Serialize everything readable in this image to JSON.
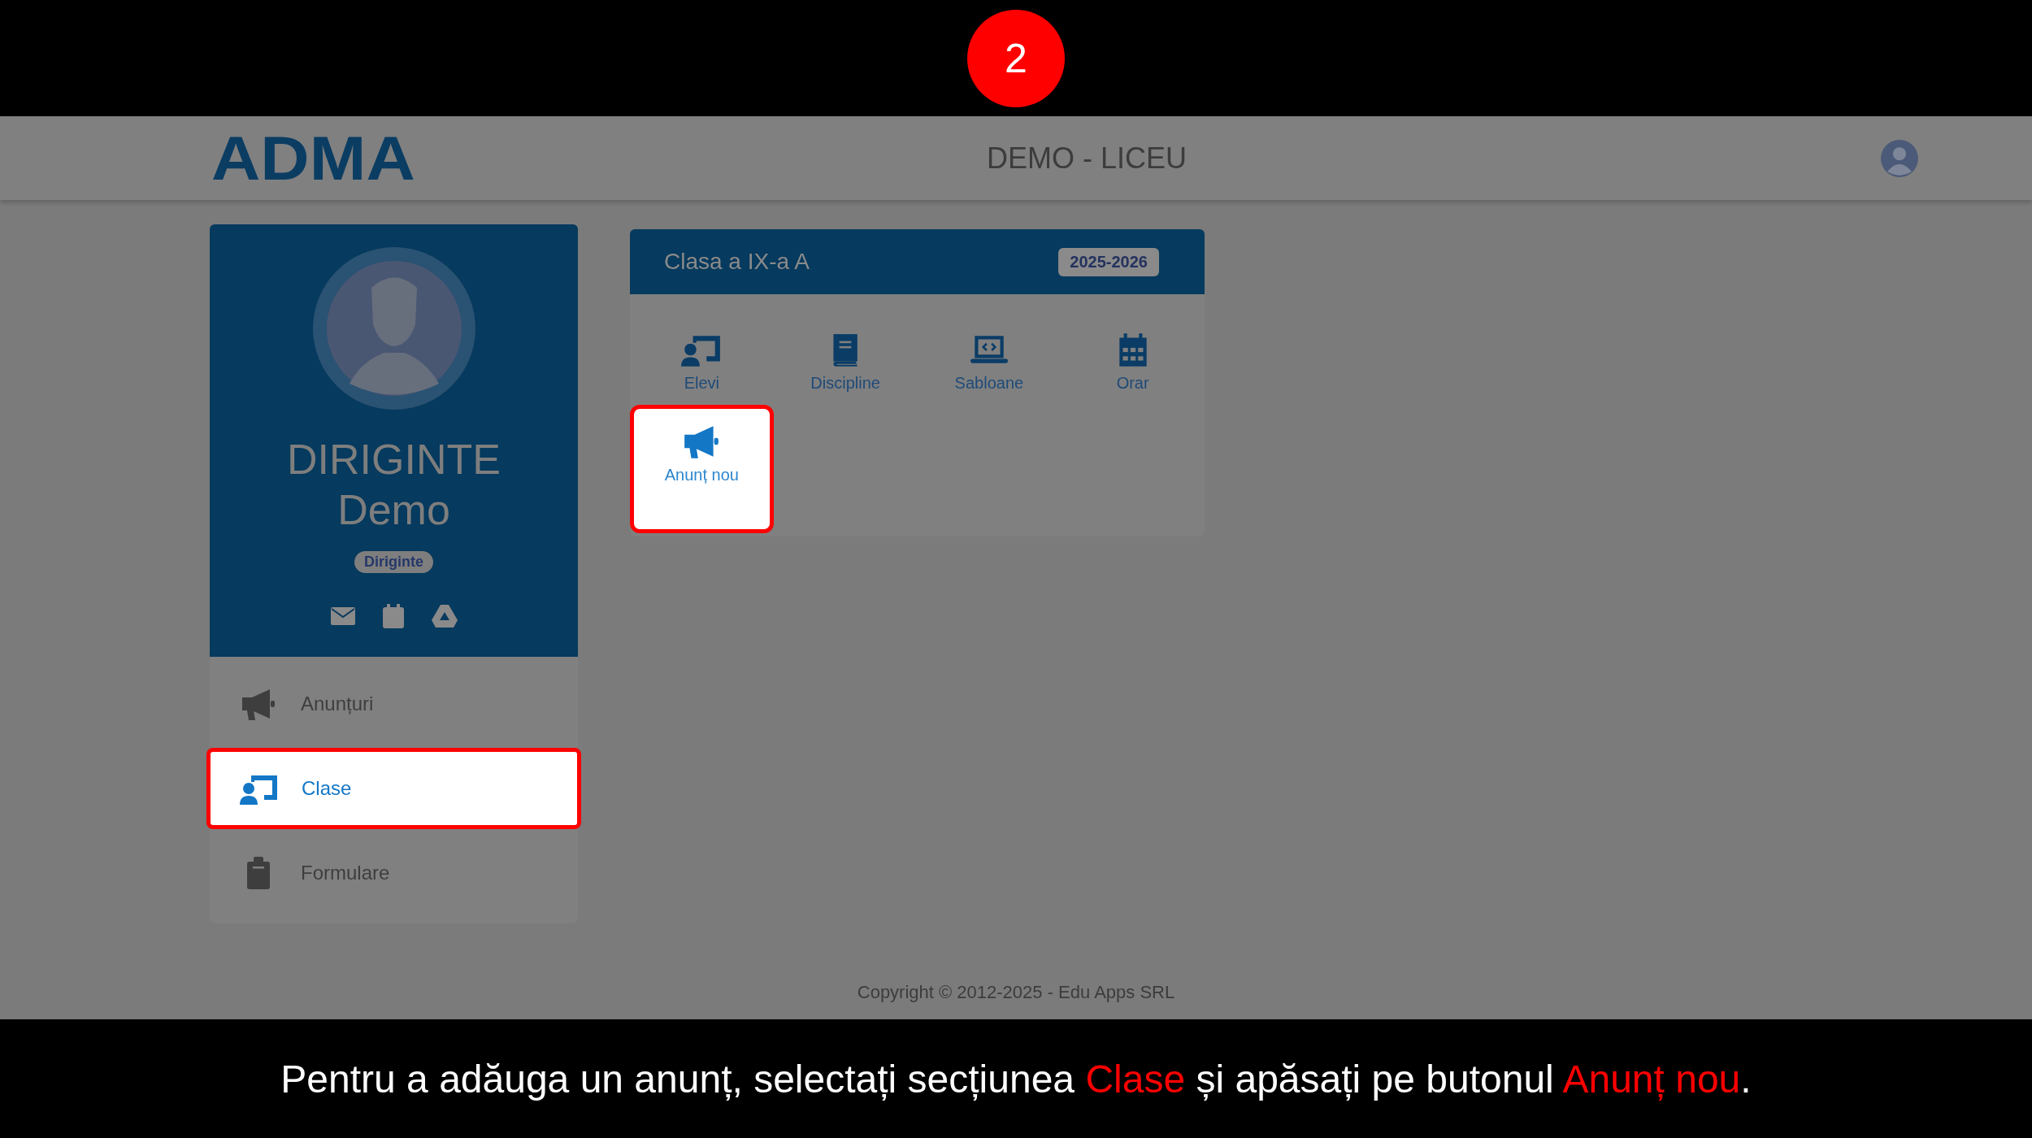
{
  "step_badge": "2",
  "header": {
    "logo": "ADMA",
    "title": "DEMO - LICEU"
  },
  "profile": {
    "name_line_1": "DIRIGINTE",
    "name_line_2": "Demo",
    "role": "Diriginte"
  },
  "menu": [
    {
      "label": "Anunțuri",
      "kind": "megaphone",
      "selected": false,
      "highlighted": false
    },
    {
      "label": "Clase",
      "kind": "teacher",
      "selected": true,
      "highlighted": true
    },
    {
      "label": "Formulare",
      "kind": "clipboard",
      "selected": false,
      "highlighted": false
    }
  ],
  "class_card": {
    "title": "Clasa a IX-a A",
    "year": "2025-2026",
    "tiles": [
      {
        "label": "Elevi",
        "kind": "teacher",
        "highlighted": false
      },
      {
        "label": "Discipline",
        "kind": "book",
        "highlighted": false
      },
      {
        "label": "Sabloane",
        "kind": "laptop",
        "highlighted": false
      },
      {
        "label": "Orar",
        "kind": "calendar",
        "highlighted": false
      },
      {
        "label": "Anunț nou",
        "kind": "megaphone",
        "highlighted": true
      }
    ]
  },
  "footer": "Copyright © 2012-2025 - Edu Apps SRL",
  "caption": [
    {
      "text": "Pentru a adăuga un anunț, selectați secțiunea ",
      "highlight": false
    },
    {
      "text": "Clase",
      "highlight": true
    },
    {
      "text": " și apăsați pe butonul ",
      "highlight": false
    },
    {
      "text": "Anunț nou",
      "highlight": true
    },
    {
      "text": ".",
      "highlight": false
    }
  ]
}
